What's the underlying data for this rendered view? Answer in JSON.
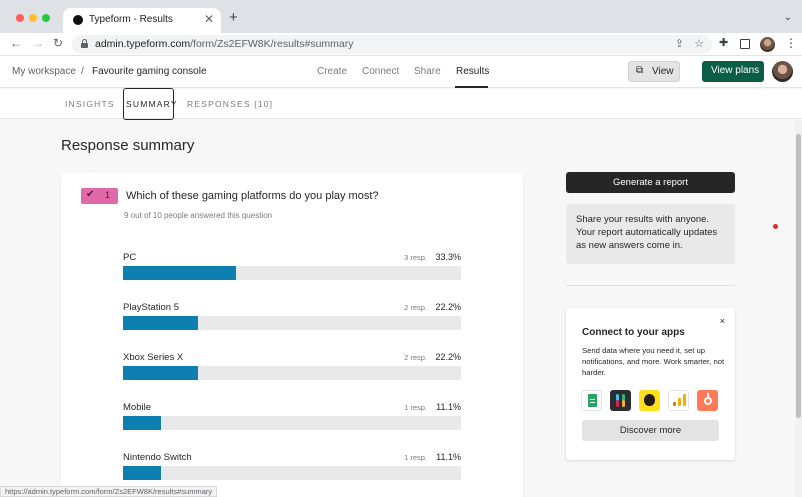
{
  "browser": {
    "tab_title": "Typeform - Results",
    "tab_close": "✕",
    "new_tab": "+",
    "url_host": "admin.typeform.com",
    "url_path": "/form/Zs2EFW8K/results#summary",
    "status_url": "https://admin.typeform.com/form/Zs2EFW8K/results#summary"
  },
  "header": {
    "workspace": "My workspace",
    "separator": "/",
    "form_name": "Favourite gaming console",
    "nav": [
      "Create",
      "Connect",
      "Share",
      "Results"
    ],
    "active_nav": "Results",
    "view_label": "View",
    "plans_label": "View plans"
  },
  "subtabs": {
    "insights": "INSIGHTS",
    "summary": "SUMMARY",
    "responses": "RESPONSES [10]"
  },
  "main": {
    "title": "Response summary",
    "question": {
      "badge_number": "1",
      "title": "Which of these gaming platforms do you play most?",
      "answered": "9 out of 10 people answered this question",
      "bar_color": "#0d7fb0",
      "options": [
        {
          "label": "PC",
          "responses": "3 resp.",
          "percent": "33.3%",
          "value": 0.333
        },
        {
          "label": "PlayStation 5",
          "responses": "2 resp.",
          "percent": "22.2%",
          "value": 0.222
        },
        {
          "label": "Xbox Series X",
          "responses": "2 resp.",
          "percent": "22.2%",
          "value": 0.222
        },
        {
          "label": "Mobile",
          "responses": "1 resp.",
          "percent": "11.1%",
          "value": 0.111
        },
        {
          "label": "Nintendo Switch",
          "responses": "1 resp.",
          "percent": "11.1%",
          "value": 0.111
        }
      ]
    }
  },
  "sidebar": {
    "report_button": "Generate a report",
    "info_text": "Share your results with anyone. Your report automatically updates as new answers come in.",
    "connect": {
      "close": "×",
      "title": "Connect to your apps",
      "description": "Send data where you need it, set up notifications, and more. Work smarter, not harder.",
      "apps": [
        "google-sheets",
        "slack",
        "mailchimp",
        "google-analytics",
        "hubspot"
      ],
      "button": "Discover more"
    }
  },
  "colors": {
    "brand_green": "#0a5e45",
    "question_badge": "#e06aa9",
    "bar_fill": "#0d7fb0"
  }
}
